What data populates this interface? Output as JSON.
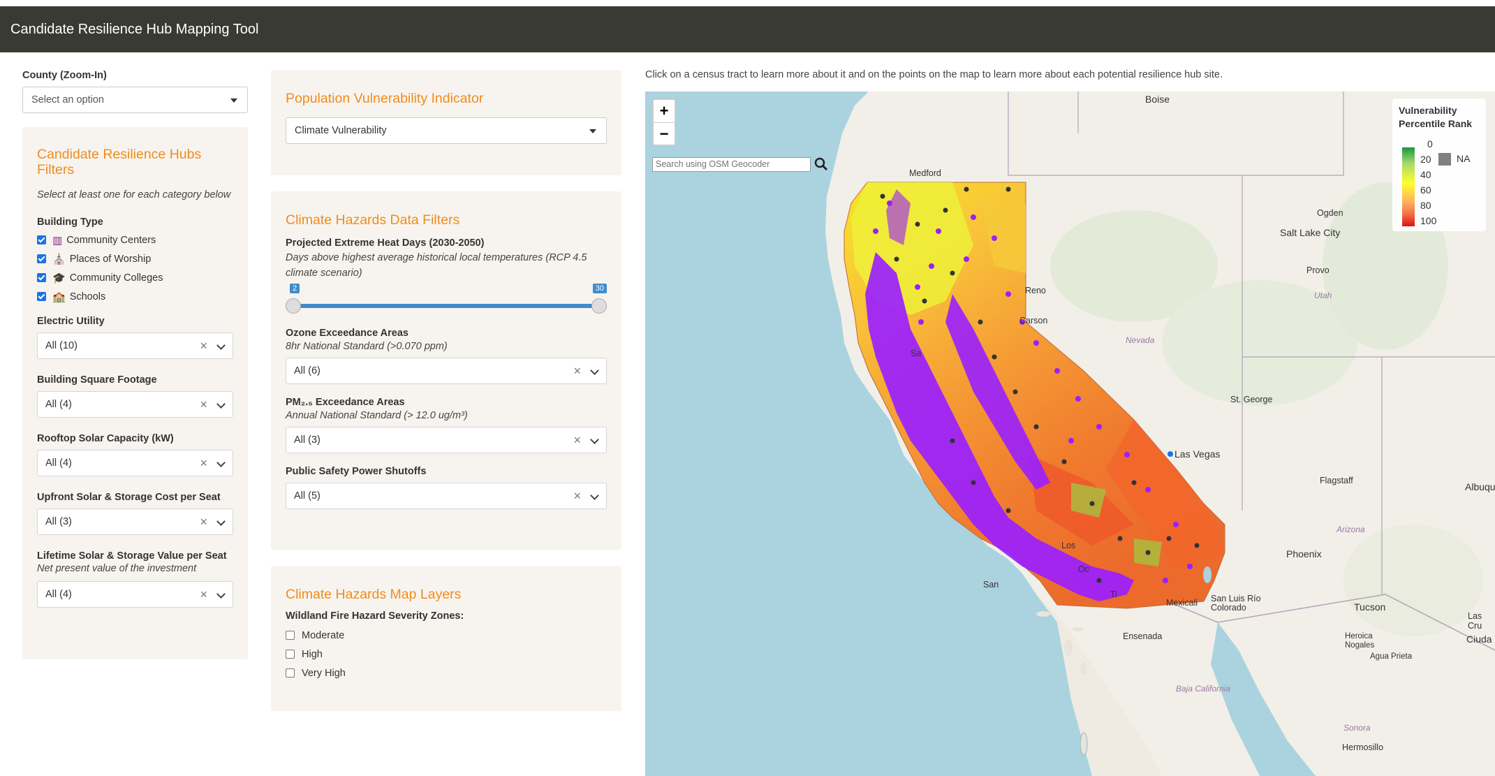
{
  "header": {
    "title": "Candidate Resilience Hub Mapping Tool"
  },
  "county": {
    "label": "County (Zoom-In)",
    "placeholder": "Select an option"
  },
  "hubs_panel": {
    "title": "Candidate Resilience Hubs Filters",
    "instruction": "Select at least one for each category below",
    "building_type": {
      "label": "Building Type",
      "options": [
        {
          "label": "Community Centers",
          "checked": true,
          "icon": "community-center-icon"
        },
        {
          "label": "Places of Worship",
          "checked": true,
          "icon": "place-of-worship-icon"
        },
        {
          "label": "Community Colleges",
          "checked": true,
          "icon": "graduation-cap-icon"
        },
        {
          "label": "Schools",
          "checked": true,
          "icon": "school-icon"
        }
      ]
    },
    "electric_utility": {
      "label": "Electric Utility",
      "value": "All (10)"
    },
    "building_sqft": {
      "label": "Building Square Footage",
      "value": "All (4)"
    },
    "rooftop_solar": {
      "label": "Rooftop Solar Capacity (kW)",
      "value": "All (4)"
    },
    "upfront_cost": {
      "label": "Upfront Solar & Storage Cost per Seat",
      "value": "All (3)"
    },
    "lifetime_value": {
      "label": "Lifetime Solar & Storage Value per Seat",
      "sublabel": "Net present value of the investment",
      "value": "All (4)"
    }
  },
  "vulnerability_panel": {
    "title": "Population Vulnerability Indicator",
    "value": "Climate Vulnerability"
  },
  "hazards_panel": {
    "title": "Climate Hazards Data Filters",
    "heat": {
      "label": "Projected Extreme Heat Days (2030-2050)",
      "sublabel": "Days above highest average historical local temperatures (RCP 4.5 climate scenario)",
      "min": "2",
      "max": "30"
    },
    "ozone": {
      "label": "Ozone Exceedance Areas",
      "sublabel": "8hr National Standard (>0.070 ppm)",
      "value": "All (6)"
    },
    "pm25": {
      "label": "PM₂.₅ Exceedance Areas",
      "sublabel": "Annual National Standard (> 12.0 ug/m³)",
      "value": "All (3)"
    },
    "psps": {
      "label": "Public Safety Power Shutoffs",
      "value": "All (5)"
    }
  },
  "layers_panel": {
    "title": "Climate Hazards Map Layers",
    "label": "Wildland Fire Hazard Severity Zones:",
    "options": [
      {
        "label": "Moderate",
        "checked": false
      },
      {
        "label": "High",
        "checked": false
      },
      {
        "label": "Very High",
        "checked": false
      }
    ]
  },
  "map": {
    "instructions": "Click on a census tract to learn more about it and on the points on the map to learn more about each potential resilience hub site.",
    "zoom_in": "+",
    "zoom_out": "−",
    "geocoder_placeholder": "Search using OSM Geocoder",
    "legend": {
      "title": "Vulnerability Percentile Rank",
      "ticks": [
        "0",
        "20",
        "40",
        "60",
        "80",
        "100"
      ],
      "na": "NA"
    },
    "places": {
      "boise": "Boise",
      "medford": "Medford",
      "ogden": "Ogden",
      "slc": "Salt Lake City",
      "provo": "Provo",
      "utah": "Utah",
      "nevada": "Nevada",
      "reno": "Reno",
      "carson": "Carson",
      "stgeorge": "St. George",
      "lasvegas": "Las Vegas",
      "flagstaff": "Flagstaff",
      "albuq": "Albuqu",
      "arizona": "Arizona",
      "phoenix": "Phoenix",
      "tucson": "Tucson",
      "lascruces": "Las Cru",
      "ciudad": "Ciuda",
      "mexicali": "Mexicali",
      "sanluis": "San Luis Río Colorado",
      "ensenada": "Ensenada",
      "heroica": "Heroica Nogales",
      "aguaprieta": "Agua Prieta",
      "sonora": "Sonora",
      "hermosillo": "Hermosillo",
      "bajacal": "Baja California",
      "los": "Los",
      "sa": "Sa",
      "oc": "Oc",
      "ti": "Ti",
      "san": "San",
      "sf": "Sa"
    },
    "colors": {
      "hub_points": "#9a1fff",
      "hub_dark": "#333333",
      "water": "#aad3df",
      "land": "#f2efe9"
    }
  }
}
